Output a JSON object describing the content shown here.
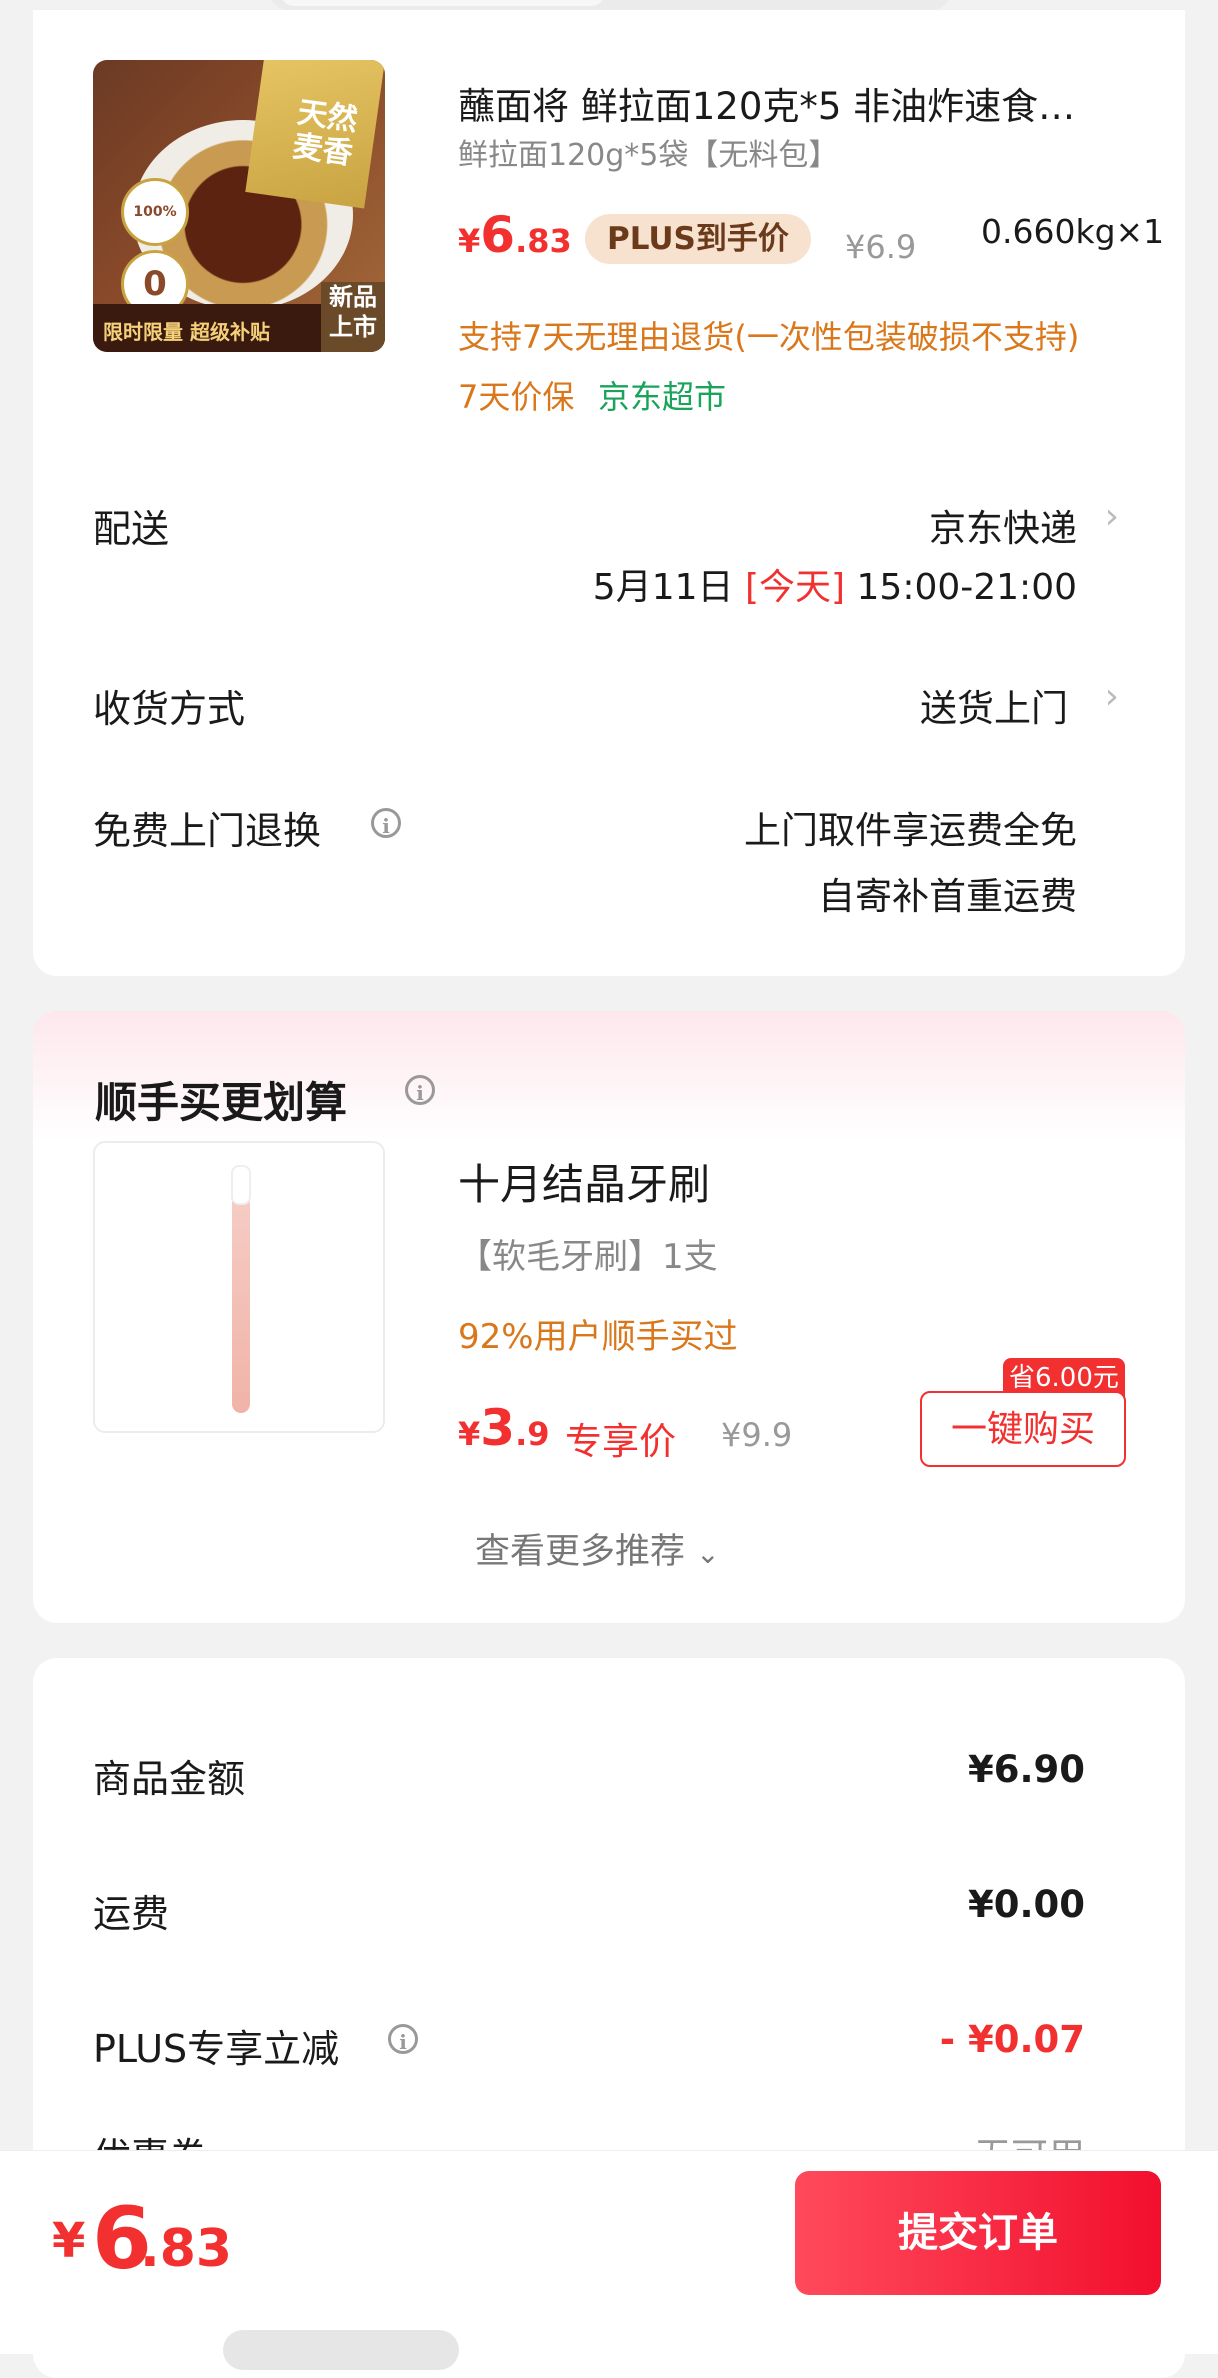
{
  "product": {
    "title": "蘸面将 鲜拉面120克*5 非油炸速食…",
    "spec": "鲜拉面120g*5袋【无料包】",
    "price_symbol": "¥",
    "price_int": "6",
    "price_dec": ".83",
    "plus_tag": "PLUS到手价",
    "original_price": "¥6.9",
    "weight_qty": "0.660kg×1",
    "return_note": "支持7天无理由退货(一次性包装破损不支持)",
    "price_protect": "7天价保",
    "store_tag": "京东超市",
    "image": {
      "pack_text": "天然\n麦香",
      "badge_100": "100%",
      "badge_0": "0",
      "banner_text": "限时限量 超级补贴",
      "new_badge": "新品\n上市"
    }
  },
  "delivery": {
    "label": "配送",
    "carrier": "京东快递",
    "date": "5月11日",
    "today": "[今天]",
    "time": "15:00-21:00"
  },
  "receive": {
    "label": "收货方式",
    "value": "送货上门"
  },
  "free_return": {
    "label": "免费上门退换",
    "line1": "上门取件享运费全免",
    "line2": "自寄补首重运费"
  },
  "addon": {
    "title": "顺手买更划算",
    "item_title": "十月结晶牙刷",
    "item_spec": "【软毛牙刷】1支",
    "item_stat": "92%用户顺手买过",
    "price_symbol": "¥",
    "price_int": "3",
    "price_dec": ".9",
    "exclusive": "专享价",
    "original_price": "¥9.9",
    "save_tag": "省6.00元",
    "buy_button": "一键购买",
    "more": "查看更多推荐"
  },
  "summary": {
    "goods_label": "商品金额",
    "goods_value": "¥6.90",
    "shipping_label": "运费",
    "shipping_value": "¥0.00",
    "plus_label": "PLUS专享立减",
    "plus_value": "- ¥0.07",
    "coupon_label": "优惠券",
    "coupon_value": "无可用"
  },
  "footer": {
    "total_symbol": "¥",
    "total_int": "6",
    "total_dec": ".83",
    "submit": "提交订单"
  },
  "colors": {
    "accent": "#f23030",
    "orange": "#d9771a",
    "green": "#1aa35a"
  }
}
